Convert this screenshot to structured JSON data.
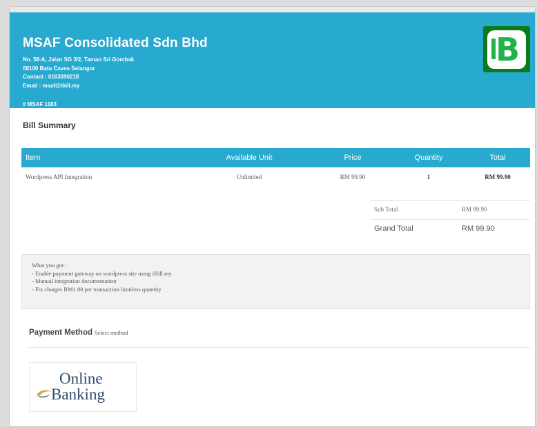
{
  "header": {
    "company": "MSAF Consolidated Sdn Bhd",
    "address": [
      "No. 58-A, Jalan SG 3/2, Taman Sri Gombak",
      "68100 Batu Caves Selangor"
    ],
    "contact": "Contact : 0163090218",
    "email": "Email : msaf@ibill.my",
    "bill_no": "# MSAF 1183",
    "logo_icon": "ibill-logo-icon",
    "color": "#27a9d0"
  },
  "summary": {
    "title": "Bill Summary",
    "columns": [
      "Item",
      "Available Unit",
      "Price",
      "Quantity",
      "Total"
    ],
    "rows": [
      [
        "Wordpress API Integration",
        "Unlimited",
        "RM 99.90",
        "1",
        "RM 99.90"
      ]
    ],
    "subtotal_label": "Sub Total",
    "subtotal_value": "RM 99.90",
    "grand_label": "Grand Total",
    "grand_value": "RM 99.90"
  },
  "what_you_got": [
    "What you got :",
    "- Enable payment gateway on wordpress site using iBill.my",
    "- Manual integration documentation",
    "- Fix charges RM1.80 per transaction limitless quantity"
  ],
  "payment": {
    "title": "Payment Method",
    "subtitle": "Select method",
    "option_line1": "Online",
    "option_line2": "Banking"
  }
}
